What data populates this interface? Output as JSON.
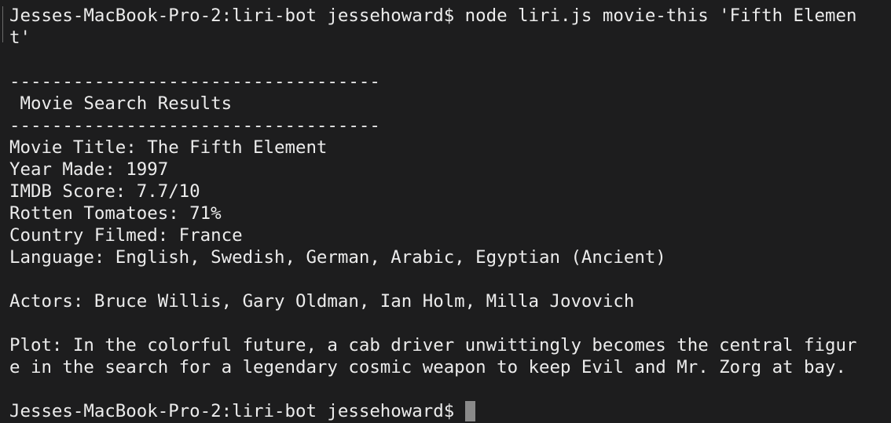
{
  "terminal": {
    "lines": [
      "Jesses-MacBook-Pro-2:liri-bot jessehoward$ node liri.js movie-this 'Fifth Elemen",
      "t'",
      "",
      "-----------------------------------",
      " Movie Search Results",
      "-----------------------------------",
      "Movie Title: The Fifth Element",
      "Year Made: 1997",
      "IMDB Score: 7.7/10",
      "Rotten Tomatoes: 71%",
      "Country Filmed: France",
      "Language: English, Swedish, German, Arabic, Egyptian (Ancient)",
      "",
      "Actors: Bruce Willis, Gary Oldman, Ian Holm, Milla Jovovich",
      "",
      "Plot: In the colorful future, a cab driver unwittingly becomes the central figur",
      "e in the search for a legendary cosmic weapon to keep Evil and Mr. Zorg at bay.",
      "",
      "Jesses-MacBook-Pro-2:liri-bot jessehoward$"
    ]
  }
}
